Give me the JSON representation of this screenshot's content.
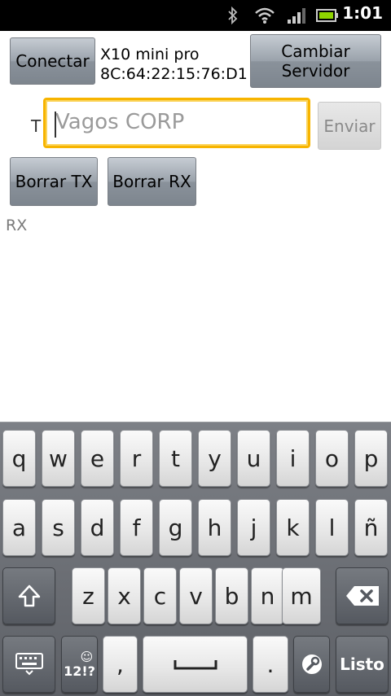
{
  "status_bar": {
    "time": "1:01"
  },
  "controls": {
    "connect_label": "Conectar",
    "device_name": "X10 mini pro",
    "device_address": "8C:64:22:15:76:D1",
    "change_server_line1": "Cambiar",
    "change_server_line2": "Servidor",
    "t_label": "T",
    "message_placeholder": "Vagos CORP",
    "send_label": "Enviar",
    "clear_tx_label": "Borrar TX",
    "clear_rx_label": "Borrar RX",
    "rx_label": "RX"
  },
  "keyboard": {
    "row1": [
      "q",
      "w",
      "e",
      "r",
      "t",
      "y",
      "u",
      "i",
      "o",
      "p"
    ],
    "row2": [
      "a",
      "s",
      "d",
      "f",
      "g",
      "h",
      "j",
      "k",
      "l",
      "ñ"
    ],
    "row3": [
      "z",
      "x",
      "c",
      "v",
      "b",
      "n",
      "m"
    ],
    "symbols_key": "12!?",
    "comma_key": ",",
    "period_key": ".",
    "done_key": "Listo"
  }
}
